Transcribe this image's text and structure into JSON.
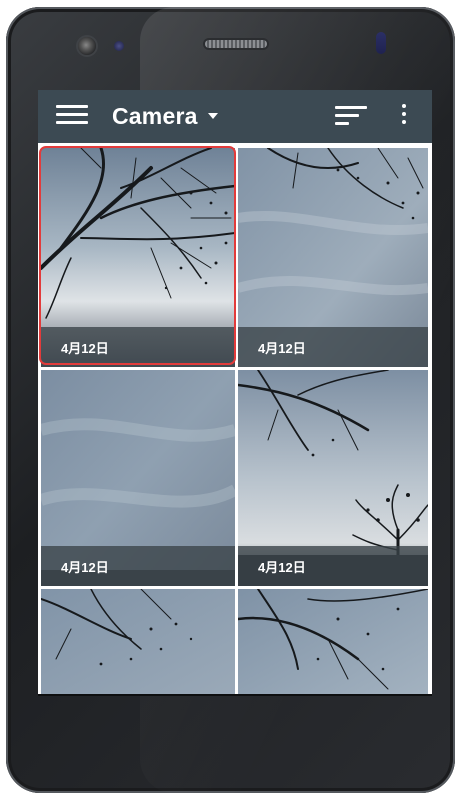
{
  "app_bar": {
    "title": "Camera",
    "icons": {
      "menu": "hamburger-menu-icon",
      "dropdown": "caret-down-icon",
      "sort": "sort-icon",
      "more": "more-vertical-icon"
    }
  },
  "photos": [
    {
      "date": "4月12日",
      "selected": true
    },
    {
      "date": "4月12日",
      "selected": false
    },
    {
      "date": "4月12日",
      "selected": false
    },
    {
      "date": "4月12日",
      "selected": false
    },
    {
      "date": "",
      "selected": false
    },
    {
      "date": "",
      "selected": false
    }
  ],
  "colors": {
    "app_bar": "#3c4a53",
    "selection_outline": "#e23b3b",
    "caption_overlay": "#3a4248",
    "device_body": "#2a2c30"
  }
}
